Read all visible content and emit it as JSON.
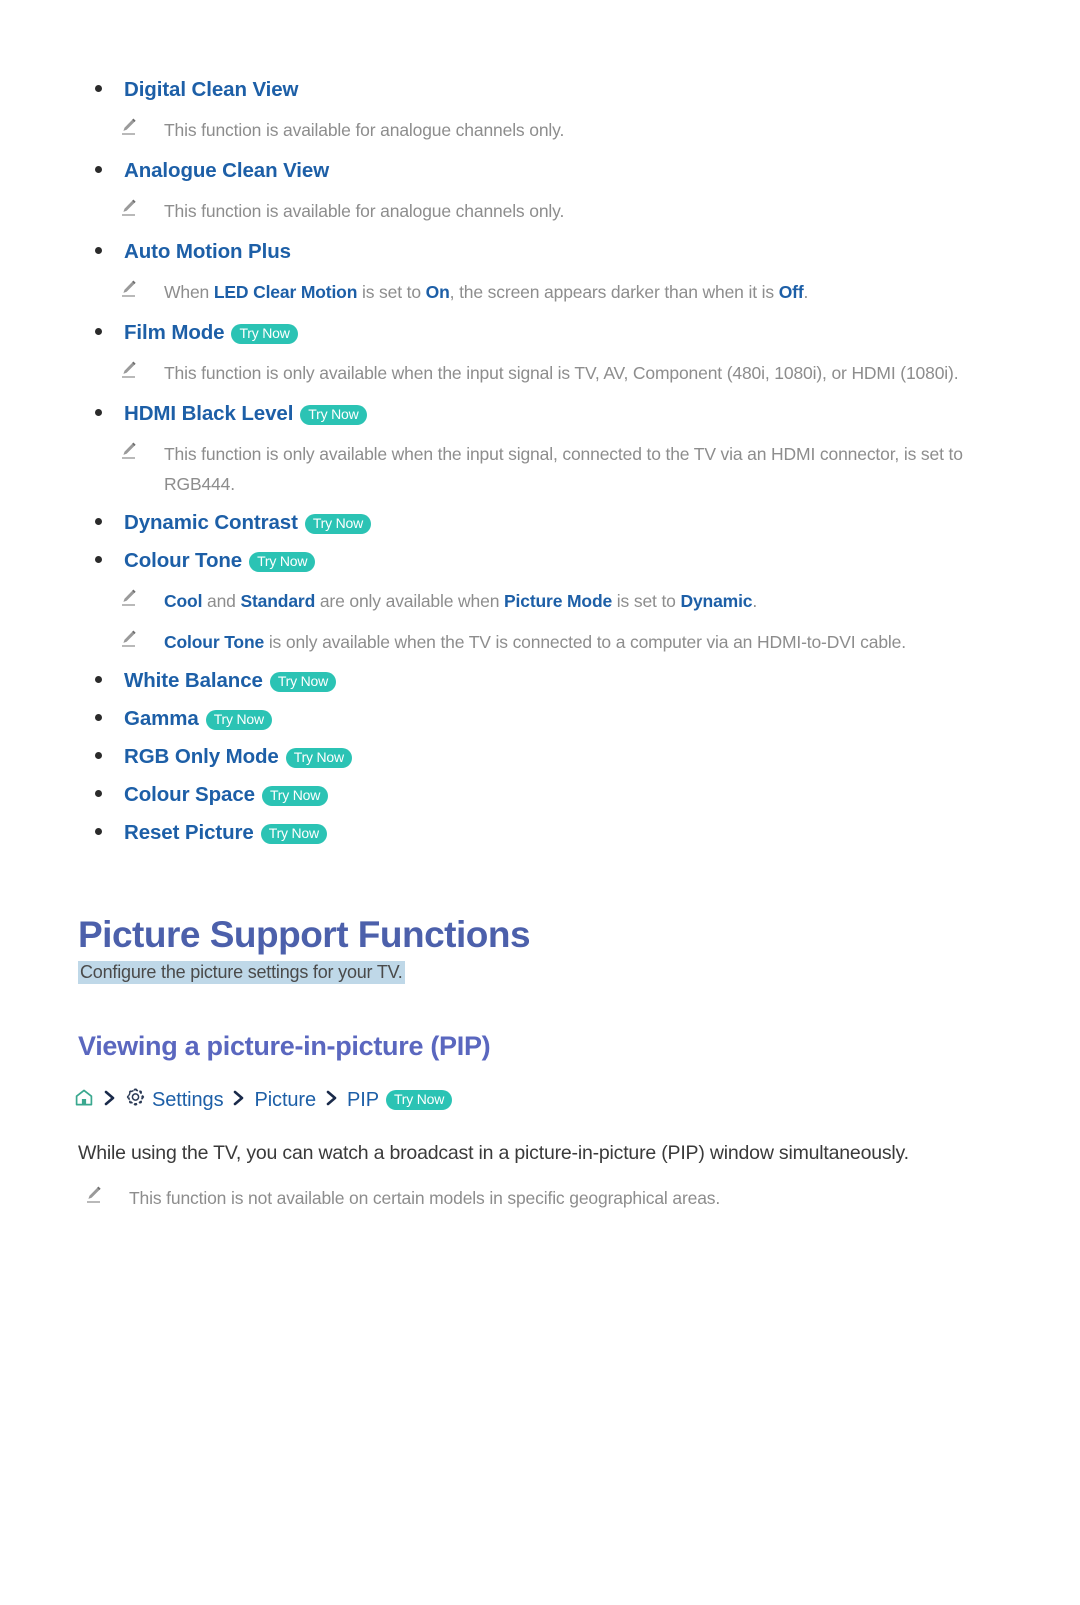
{
  "document": {
    "bullets": [
      {
        "id": "digital-clean-view",
        "label": "Digital Clean View",
        "badge": null
      },
      {
        "id": "analogue-clean-view",
        "label": "Analogue Clean View",
        "badge": null
      },
      {
        "id": "auto-motion-plus",
        "label": "Auto Motion Plus",
        "badge": null
      },
      {
        "id": "film-mode",
        "label": "Film Mode",
        "badge": "Try Now"
      },
      {
        "id": "hdmi-black-level",
        "label": "HDMI Black Level",
        "badge": "Try Now"
      },
      {
        "id": "dynamic-contrast",
        "label": "Dynamic Contrast",
        "badge": "Try Now"
      },
      {
        "id": "colour-tone",
        "label": "Colour Tone",
        "badge": "Try Now"
      },
      {
        "id": "white-balance",
        "label": "White Balance",
        "badge": "Try Now"
      },
      {
        "id": "gamma",
        "label": "Gamma",
        "badge": "Try Now"
      },
      {
        "id": "rgb-only-mode",
        "label": "RGB Only Mode",
        "badge": "Try Now"
      },
      {
        "id": "colour-space",
        "label": "Colour Space",
        "badge": "Try Now"
      },
      {
        "id": "reset-picture",
        "label": "Reset Picture",
        "badge": "Try Now"
      }
    ],
    "notes": {
      "digital_clean_view": "This function is available for analogue channels only.",
      "analogue_clean_view": "This function is available for analogue channels only.",
      "auto_motion_plus": {
        "p1": "When ",
        "b1": "LED Clear Motion",
        "p2": " is set to ",
        "b2": "On",
        "p3": ", the screen appears darker than when it is ",
        "b3": "Off",
        "p4": "."
      },
      "film_mode": "This function is only available when the input signal is TV, AV, Component (480i, 1080i), or HDMI (1080i).",
      "hdmi_black_level": "This function is only available when the input signal, connected to the TV via an HDMI connector, is set to RGB444.",
      "colour_tone_1": {
        "b1": "Cool",
        "p1": " and ",
        "b2": "Standard",
        "p2": " are only available when ",
        "b3": "Picture Mode",
        "p3": " is set to ",
        "b4": "Dynamic",
        "p4": "."
      },
      "colour_tone_2": {
        "b1": "Colour Tone",
        "p1": " is only available when the TV is connected to a computer via an HDMI-to-DVI cable."
      },
      "pip": "This function is not available on certain models in specific geographical areas."
    },
    "section": {
      "title": "Picture Support Functions",
      "subtitle": "Configure the picture settings for your TV."
    },
    "subsection": {
      "title": "Viewing a picture-in-picture (PIP)",
      "breadcrumb": {
        "home_icon": "home-icon",
        "gear_icon": "gear-icon",
        "chevron_icon": "chevron-right-icon",
        "settings": "Settings",
        "picture": "Picture",
        "pip": "PIP",
        "badge": "Try Now"
      },
      "paragraph": "While using the TV, you can watch a broadcast in a picture-in-picture (PIP) window simultaneously."
    },
    "colors": {
      "link_blue": "#1d5fa7",
      "heading_blue": "#4c60ab",
      "subheading_blue": "#5a67bf",
      "badge_teal": "#2bc3b4",
      "note_gray": "#8d8d8d",
      "highlight_blue": "#bfd8e8",
      "home_icon_teal": "#3aa88f"
    }
  }
}
